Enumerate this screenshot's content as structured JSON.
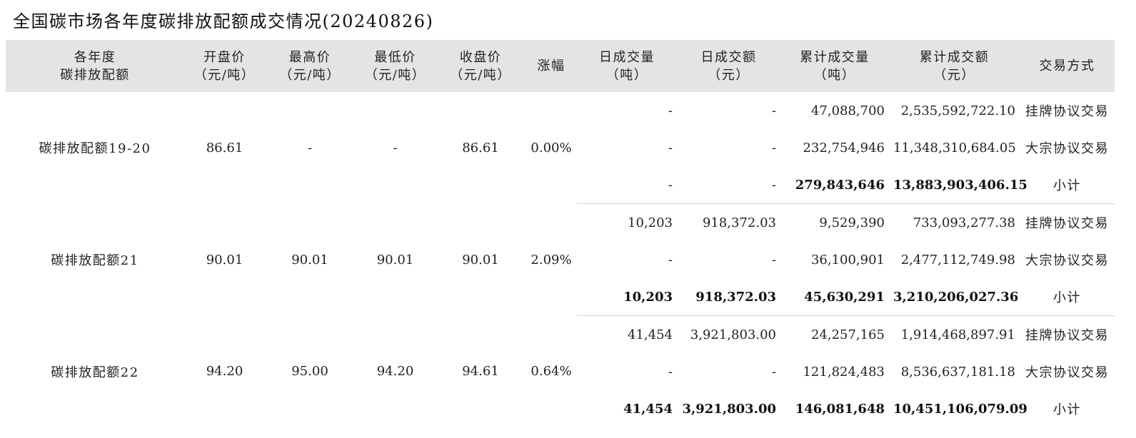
{
  "title": "全国碳市场各年度碳排放配额成交情况(20240826)",
  "headers": {
    "allowance": [
      "各年度",
      "碳排放配额"
    ],
    "open": [
      "开盘价",
      "（元/吨）"
    ],
    "high": [
      "最高价",
      "（元/吨）"
    ],
    "low": [
      "最低价",
      "（元/吨）"
    ],
    "close": [
      "收盘价",
      "（元/吨）"
    ],
    "change": [
      "涨幅"
    ],
    "daily_volume": [
      "日成交量",
      "（吨）"
    ],
    "daily_amount": [
      "日成交额",
      "（元）"
    ],
    "cum_volume": [
      "累计成交量",
      "（吨）"
    ],
    "cum_amount": [
      "累计成交额",
      "（元）"
    ],
    "method": [
      "交易方式"
    ]
  },
  "groups": [
    {
      "name": "碳排放配额19-20",
      "open": "86.61",
      "high": "-",
      "low": "-",
      "close": "86.61",
      "change": "0.00%",
      "rows": [
        {
          "daily_volume": "-",
          "daily_amount": "-",
          "cum_volume": "47,088,700",
          "cum_amount": "2,535,592,722.10",
          "method": "挂牌协议交易"
        },
        {
          "daily_volume": "-",
          "daily_amount": "-",
          "cum_volume": "232,754,946",
          "cum_amount": "11,348,310,684.05",
          "method": "大宗协议交易"
        },
        {
          "daily_volume": "-",
          "daily_amount": "-",
          "cum_volume": "279,843,646",
          "cum_amount": "13,883,903,406.15",
          "method": "小计"
        }
      ]
    },
    {
      "name": "碳排放配额21",
      "open": "90.01",
      "high": "90.01",
      "low": "90.01",
      "close": "90.01",
      "change": "2.09%",
      "rows": [
        {
          "daily_volume": "10,203",
          "daily_amount": "918,372.03",
          "cum_volume": "9,529,390",
          "cum_amount": "733,093,277.38",
          "method": "挂牌协议交易"
        },
        {
          "daily_volume": "-",
          "daily_amount": "-",
          "cum_volume": "36,100,901",
          "cum_amount": "2,477,112,749.98",
          "method": "大宗协议交易"
        },
        {
          "daily_volume": "10,203",
          "daily_amount": "918,372.03",
          "cum_volume": "45,630,291",
          "cum_amount": "3,210,206,027.36",
          "method": "小计"
        }
      ]
    },
    {
      "name": "碳排放配额22",
      "open": "94.20",
      "high": "95.00",
      "low": "94.20",
      "close": "94.61",
      "change": "0.64%",
      "rows": [
        {
          "daily_volume": "41,454",
          "daily_amount": "3,921,803.00",
          "cum_volume": "24,257,165",
          "cum_amount": "1,914,468,897.91",
          "method": "挂牌协议交易"
        },
        {
          "daily_volume": "-",
          "daily_amount": "-",
          "cum_volume": "121,824,483",
          "cum_amount": "8,536,637,181.18",
          "method": "大宗协议交易"
        },
        {
          "daily_volume": "41,454",
          "daily_amount": "3,921,803.00",
          "cum_volume": "146,081,648",
          "cum_amount": "10,451,106,079.09",
          "method": "小计"
        }
      ]
    }
  ]
}
